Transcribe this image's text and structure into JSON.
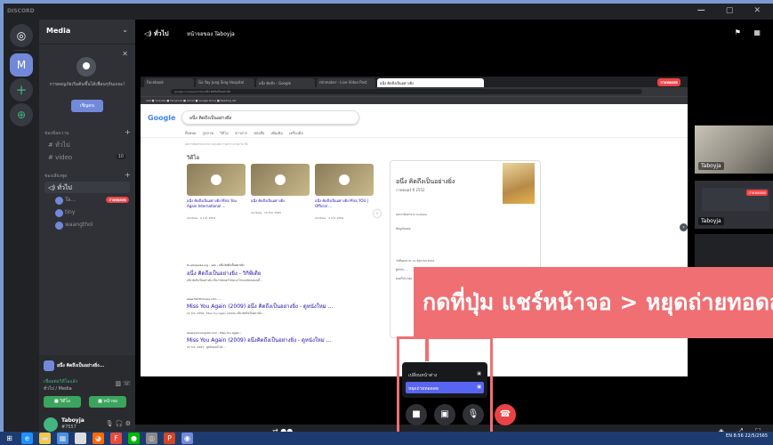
{
  "app": {
    "title": "DISCORD",
    "window_controls": "— ▢ ✕"
  },
  "guilds": {
    "home_icon": "discord-logo-icon",
    "server_letter": "M",
    "add": "+",
    "explore": "⊕"
  },
  "server": {
    "name": "Media",
    "chevron": "⌄"
  },
  "invite": {
    "close": "✕",
    "text": "การผจญภัยเริ่มต้นขึ้นได้เพื่อนๆกันเถอะ!",
    "button": "เชิญคน"
  },
  "categories": [
    {
      "label": "ช่องข้อความ",
      "channels": [
        {
          "name": "# ทั่วไป"
        },
        {
          "name": "# video",
          "count": "10"
        }
      ]
    },
    {
      "label": "ช่องเสียงพูด",
      "channels": [
        {
          "name": "◁) ทั่วไป"
        }
      ]
    }
  ],
  "voice_users": [
    {
      "name": "Ta...",
      "live": "ถ่ายทอดสด"
    },
    {
      "name": "tiny"
    },
    {
      "name": "waangthol"
    }
  ],
  "voice_panel": {
    "share_title": "อนึ่ง คิดถึงเป็นอย่างยิ่ง...",
    "status": "เชื่อมต่อวิดีโอแล้ว",
    "sub": "ทั่วไป / Media",
    "video_btn": "■ วิดีโอ",
    "screen_btn": "■ หน้าจอ"
  },
  "user": {
    "name": "Taboyja",
    "tag": "#7557",
    "icons": "🎙 🎧 ⚙"
  },
  "main": {
    "voice_channel": "◁) ทั่วไป",
    "stream_name": "หน้าจอของ Taboyja",
    "top_icons": "⚑ ▦"
  },
  "shared_screen": {
    "tabs": [
      "Facebook",
      "Go Yay Jung Sing Hospital",
      "อนึ่ง คิดถึง - Google",
      "ntnmaker - Live Video Post",
      "อนึ่ง คิดถึงเป็นอย่างยิ่ง"
    ],
    "url": "google.com/search?q=อนึ่ง คิดถึงเป็นอย่างยิ่ง",
    "bookmarks": "แอป  ■ Youtube  ■ Facebook  ■ Gmail  ■ Google Drive  ■ Reading list",
    "live_badge": "ถ่ายทอดสด",
    "logo": "Google",
    "query": "อนึ่ง คิดถึงเป็นอย่างยิ่ง",
    "search_tabs": "ทั้งหมด  รูปภาพ  วิดีโอ  ข่าวสาร  หนังสือ  เพิ่มเติม  เครื่องมือ",
    "info": "ผลการค้นหาประมาณ 129,000 รายการ (0.56 วินาที)",
    "videos_label": "วิดีโอ",
    "videos": [
      {
        "title": "อนึ่ง คิดถึงเป็นอย่างยิ่ง Miss You Again International ...",
        "src": "YouTube · 9 ก.ค. 2554"
      },
      {
        "title": "อนึ่ง คิดถึงเป็นอย่างยิ่ง",
        "src": "YouTube · 15 มิ.ย. 2565"
      },
      {
        "title": "อนึ่ง คิดถึงเป็นอย่างยิ่ง Miss YOU | Official ...",
        "src": "YouTube · 3 ก.ค. 2554"
      }
    ],
    "kp_title": "อนึ่ง คิดถึงเป็นอย่างยิ่ง",
    "kp_sub": "ภาพยนตร์ ปี 2552",
    "kp_rows": [
      "ผลการค้นหาจาก YouTube",
      "ข้อมูลโดยย่อ",
      "วันที่ออกฉาย: 11 มิถุนายน 2552",
      "ผู้กำกับ: ...",
      "ดนตรีประกอบ: ..."
    ],
    "results": [
      {
        "src": "th.wikipedia.org › wiki › อนึ่ง คิดถึงเป็นอย่างยิ่ง",
        "t": "อนึ่ง คิดถึงเป็นอย่างยิ่ง - วิกิพีเดีย",
        "d": "อนึ่ง คิดถึงเป็นอย่างยิ่ง เป็นภาพยนตร์ไทยแนวโรแมนติกคอมเมดี้..."
      },
      {
        "src": "www.567thmovie.com › ...",
        "t": "Miss You Again (2009) อนึ่ง คิดถึงเป็นอย่างยิ่ง - ดูหนังใหม่ ...",
        "d": "11 ส.ค. 2558 · Miss You Again (2009) อนึ่ง คิดถึงเป็นอย่างยิ่ง ..."
      },
      {
        "src": "www.pannongslot.com › Miss You Again ›",
        "t": "Miss You Again (2009) อนึ่งคิดถึงเป็นอย่างยิ่ง - ดูหนังใหม่ ...",
        "d": "22 ส.ค. 2563 · ดูหนังออนไลน์ ..."
      }
    ]
  },
  "tiles": [
    {
      "name": "Taboyja"
    },
    {
      "name": "Taboyja",
      "live": "ถ่ายทอดสด"
    },
    {
      "name": ""
    }
  ],
  "banner": "กดที่ปุ่ม แชร์หน้าจอ > หยุดถ่ายทอดสด",
  "popup": {
    "item1": "เปลี่ยนหน้าต่าง",
    "item2": "หยุดถ่ายทอดสด"
  },
  "controls": {
    "camera": "■",
    "screen": "▣",
    "mic": "🎙",
    "end": "☎"
  },
  "bottom": {
    "left": "⇄ ●●",
    "right": "◈ ⤢ ⛶"
  },
  "taskbar": {
    "start": "⊞",
    "time": "8:56",
    "date": "22/5/2565",
    "lang": "EN"
  },
  "colors": {
    "accent": "#7289da",
    "live": "#ed4245",
    "banner": "#f06f73",
    "online": "#43b581"
  }
}
